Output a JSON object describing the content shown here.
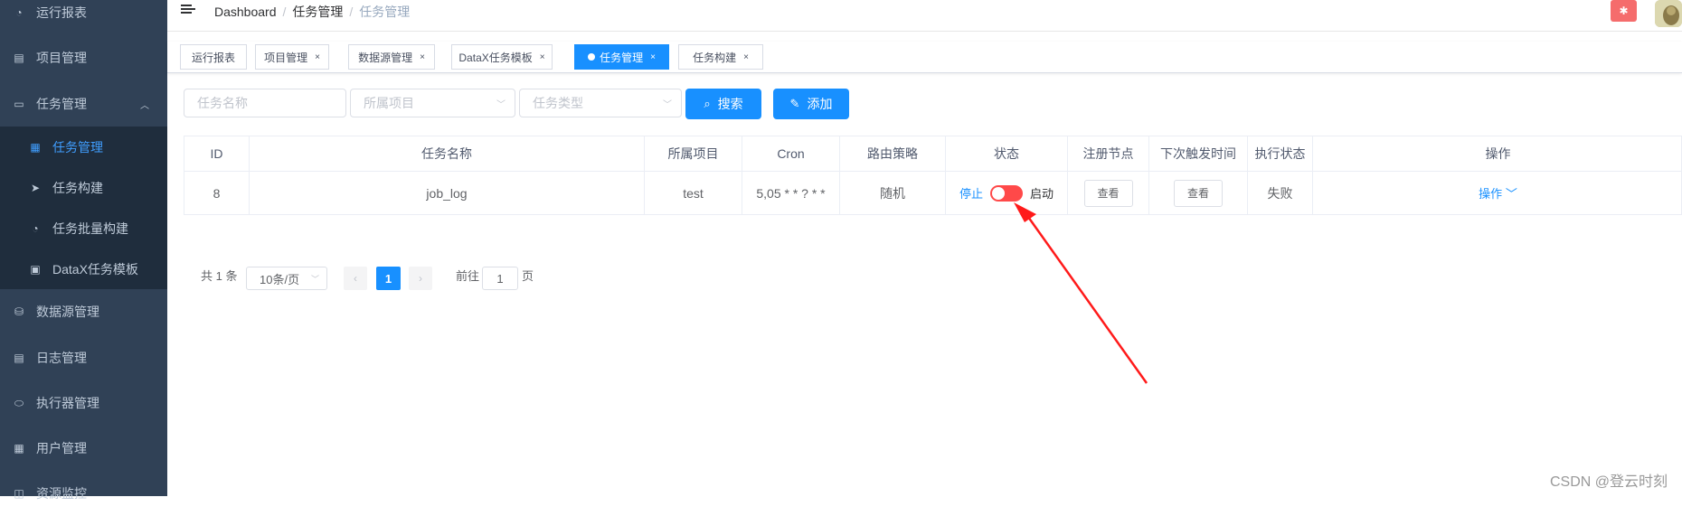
{
  "sidebar": {
    "items": [
      {
        "label": "运行报表",
        "icon": "dashboard-icon"
      },
      {
        "label": "项目管理",
        "icon": "project-icon"
      },
      {
        "label": "任务管理",
        "icon": "monitor-icon"
      },
      {
        "label": "数据源管理",
        "icon": "database-icon"
      },
      {
        "label": "日志管理",
        "icon": "log-icon"
      },
      {
        "label": "执行器管理",
        "icon": "executor-icon"
      },
      {
        "label": "用户管理",
        "icon": "user-table-icon"
      },
      {
        "label": "资源监控",
        "icon": "monitor-icon"
      }
    ],
    "sub_items": [
      {
        "label": "任务管理",
        "icon": "calendar-icon"
      },
      {
        "label": "任务构建",
        "icon": "send-icon"
      },
      {
        "label": "任务批量构建",
        "icon": "dashboard-icon"
      },
      {
        "label": "DataX任务模板",
        "icon": "clipboard-icon"
      }
    ]
  },
  "header": {
    "breadcrumb": [
      "Dashboard",
      "任务管理",
      "任务管理"
    ]
  },
  "tags": [
    {
      "label": "运行报表"
    },
    {
      "label": "项目管理"
    },
    {
      "label": "数据源管理"
    },
    {
      "label": "DataX任务模板"
    },
    {
      "label": "任务管理"
    },
    {
      "label": "任务构建"
    }
  ],
  "filters": {
    "task_name_placeholder": "任务名称",
    "project_placeholder": "所属项目",
    "task_type_placeholder": "任务类型",
    "search_label": "搜索",
    "add_label": "添加"
  },
  "table": {
    "headers": [
      "ID",
      "任务名称",
      "所属项目",
      "Cron",
      "路由策略",
      "状态",
      "注册节点",
      "下次触发时间",
      "执行状态",
      "操作"
    ],
    "rows": [
      {
        "id": "8",
        "name": "job_log",
        "project": "test",
        "cron": "5,05 * * ? * *",
        "route": "随机",
        "status_off": "停止",
        "status_on": "启动",
        "register_btn": "查看",
        "next_trigger_btn": "查看",
        "exec_status": "失败",
        "action": "操作"
      }
    ]
  },
  "pagination": {
    "total": "共 1 条",
    "page_size": "10条/页",
    "current": "1",
    "goto_label": "前往",
    "goto_value": "1",
    "page_unit": "页"
  },
  "watermark": "CSDN @登云时刻",
  "colors": {
    "primary": "#1890ff",
    "sidebar": "#304156",
    "danger": "#ff4949",
    "annotation": "#ff0000"
  }
}
